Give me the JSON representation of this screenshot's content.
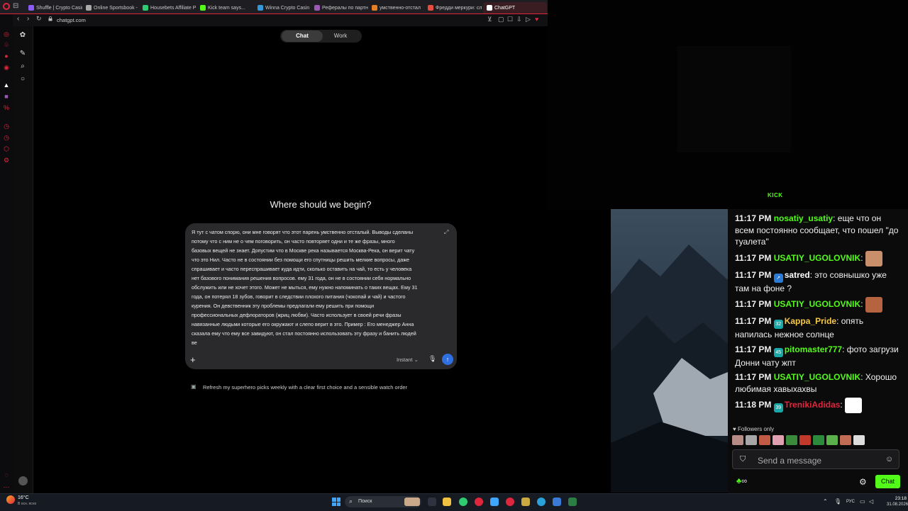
{
  "browser": {
    "tabs": [
      {
        "label": "Shuffle | Crypto Casin",
        "color": "#8a5cf6"
      },
      {
        "label": "Online Sportsbook -",
        "color": "#aaaaaa"
      },
      {
        "label": "Housebets Affiliate P",
        "color": "#2ecc71"
      },
      {
        "label": "Kick team says...",
        "color": "#53fc18"
      },
      {
        "label": "Winna Crypto Casin",
        "color": "#3498db"
      },
      {
        "label": "Рефералы по партне",
        "color": "#9b59b6"
      },
      {
        "label": "умственно-отстал",
        "color": "#e67e22"
      },
      {
        "label": "Фредди меркури: сл",
        "color": "#e74c3c"
      },
      {
        "label": "ChatGPT",
        "color": "#ffffff"
      }
    ],
    "url": "chatgpt.com"
  },
  "chatgpt": {
    "toggle": {
      "chat": "Chat",
      "work": "Work"
    },
    "heading": "Where should we begin?",
    "composer_text": "Я тут с чатом спорю, они мне говорят что этот парень умственно отсталый. Выводы сделаны\nпотому что с ним не о чем поговорить, он часто повторяет одни и те же фразы, много\nбазовых вещей не знает. Допустим что в Москве река называется Москва-Река, он верит чату\nчто это Нил. Часто не в состоянии без помощи его спутницы решить мелкие вопросы, даже\nспрашивает и часто переспрашивает куда идти, сколько оставить на чай, то есть у человека\nнет базового понимания решения вопросов. ему 31 года, он не в состоянии себя нормально\nобслужить или не хочет этого. Может не мыться, ему нужно напоминать о таких вещах. Ему 31\nгода, он потерял 18 зубов, говорит в следствии плохого питания (чокопай и чай) и частого\nкурения. Он девственник эту проблемы предлагали ему решить при помощи\nпрофессиональных дефлораторов (жриц любви). Часто использует в своей речи фразы\nнавязанные людьми которые его окружают и слепо верит в это. Пример : Его менеджер Анна\nсказала ему что ему все завидуют, он стал постоянно использовать эту фразу и банить людей\nве",
    "model": "Instant",
    "suggestion": "Refresh my superhero picks weekly with a clear first choice and a sensible watch order"
  },
  "stream": {
    "kick_logo": "KICK",
    "chat_lines": [
      {
        "time": "11:17 PM",
        "user": "nosatiy_usatiy",
        "user_color": "#53fc18",
        "badge": "",
        "text": "еще что он всем постоянно сообщает, что пошел \"до туалета\"",
        "emote": false
      },
      {
        "time": "11:17 PM",
        "user": "USATIY_UGOLOVNIK",
        "user_color": "#53fc18",
        "badge": "",
        "text": "",
        "emote": true
      },
      {
        "time": "11:17 PM",
        "user": "satred",
        "user_color": "#ffffff",
        "badge": "↗",
        "badge_color": "#2b7bd6",
        "text": "это совнышко уже там на фоне ?",
        "emote": false
      },
      {
        "time": "11:17 PM",
        "user": "USATIY_UGOLOVNIK",
        "user_color": "#53fc18",
        "badge": "",
        "text": "",
        "emote": true
      },
      {
        "time": "11:17 PM",
        "user": "Kappa_Pride",
        "user_color": "#f7c948",
        "badge": "32",
        "badge_color": "#1aa7a7",
        "text": "опять напилась нежное солнце",
        "emote": false
      },
      {
        "time": "11:17 PM",
        "user": "pitomaster777",
        "user_color": "#53fc18",
        "badge": "45",
        "badge_color": "#1aa7a7",
        "text": "фото загрузи Донни чату жпт",
        "emote": false
      },
      {
        "time": "11:17 PM",
        "user": "USATIY_UGOLOVNIK",
        "user_color": "#53fc18",
        "badge": "",
        "text": "Хорошо любимая хавыхахвы",
        "emote": false
      },
      {
        "time": "11:18 PM",
        "user": "TrenikiAdidas",
        "user_color": "#e0263d",
        "badge": "39",
        "badge_color": "#1aa7a7",
        "text": "",
        "emote": true
      }
    ],
    "followers_only": "Followers only",
    "message_placeholder": "Send a message",
    "chat_button": "Chat",
    "infinite_symbol": "∞"
  },
  "taskbar": {
    "weather_temp": "16°C",
    "weather_desc": "В осн. ясно",
    "search_label": "Поиск",
    "language": "РУС",
    "time": "23:18",
    "date": "31.08.2026"
  }
}
